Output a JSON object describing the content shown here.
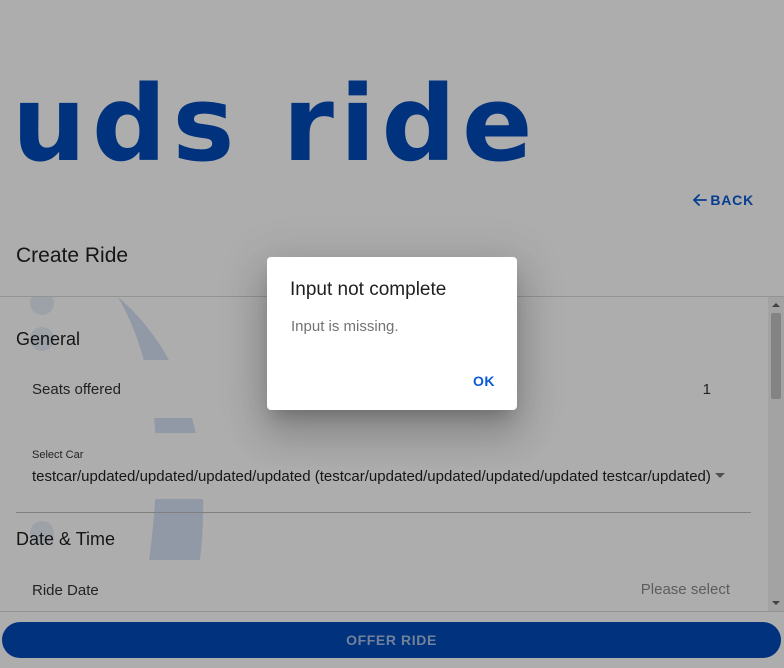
{
  "app": {
    "logo_text": "uds ride",
    "brand_color": "#004bb8"
  },
  "header": {
    "back_label": "BACK",
    "back_icon": "arrow-left-icon",
    "page_title": "Create Ride"
  },
  "form": {
    "general": {
      "title": "General",
      "seats_label": "Seats offered",
      "seats_value": "1",
      "car_label": "Select Car",
      "car_value": "testcar/updated/updated/updated/updated (testcar/updated/updated/updated/updated testcar/updated)",
      "car_icon": "chevron-down-icon"
    },
    "date_time": {
      "title": "Date & Time",
      "ride_date_label": "Ride Date",
      "ride_date_placeholder": "Please select"
    }
  },
  "footer": {
    "offer_label": "OFFER RIDE"
  },
  "dialog": {
    "title": "Input not complete",
    "message": "Input is missing.",
    "ok_label": "OK"
  }
}
